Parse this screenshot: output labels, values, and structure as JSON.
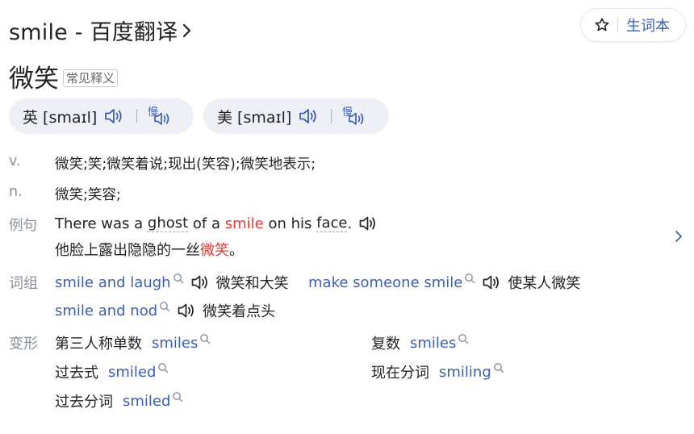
{
  "header": {
    "title": "smile - 百度翻译",
    "vocab_label": "生词本"
  },
  "entry": {
    "headword": "微笑",
    "tag": "常见释义"
  },
  "pronunciations": [
    {
      "text": "英 [smaɪl]"
    },
    {
      "text": "美 [smaɪl]"
    }
  ],
  "definitions": [
    {
      "pos": "v.",
      "meaning": "微笑;笑;微笑着说;现出(笑容);微笑地表示;"
    },
    {
      "pos": "n.",
      "meaning": "微笑;笑容;"
    }
  ],
  "example": {
    "label": "例句",
    "en_1": "There was a ",
    "en_ghost": "ghost",
    "en_2": " of a ",
    "en_hl": "smile",
    "en_3": " on his ",
    "en_face": "face",
    "en_4": ".",
    "zh_1": "他脸上露出隐隐的一丝",
    "zh_hl": "微笑",
    "zh_2": "。"
  },
  "phrases": {
    "label": "词组",
    "items": [
      {
        "en": "smile and laugh",
        "zh": "微笑和大笑"
      },
      {
        "en": "make someone smile",
        "zh": "使某人微笑"
      },
      {
        "en": "smile and nod",
        "zh": "微笑着点头"
      }
    ]
  },
  "forms": {
    "label": "变形",
    "items": [
      {
        "label": "第三人称单数",
        "word": "smiles"
      },
      {
        "label": "复数",
        "word": "smiles"
      },
      {
        "label": "过去式",
        "word": "smiled"
      },
      {
        "label": "现在分词",
        "word": "smiling"
      },
      {
        "label": "过去分词",
        "word": "smiled"
      }
    ]
  },
  "colors": {
    "link_blue": "#3c5fb8",
    "highlight_red": "#e53935",
    "pill_bg": "#eef0f5",
    "label_gray": "#8a8f99"
  },
  "icons": [
    "chevron-right-icon",
    "star-icon",
    "speaker-icon",
    "slow-speaker-icon",
    "search-icon"
  ]
}
